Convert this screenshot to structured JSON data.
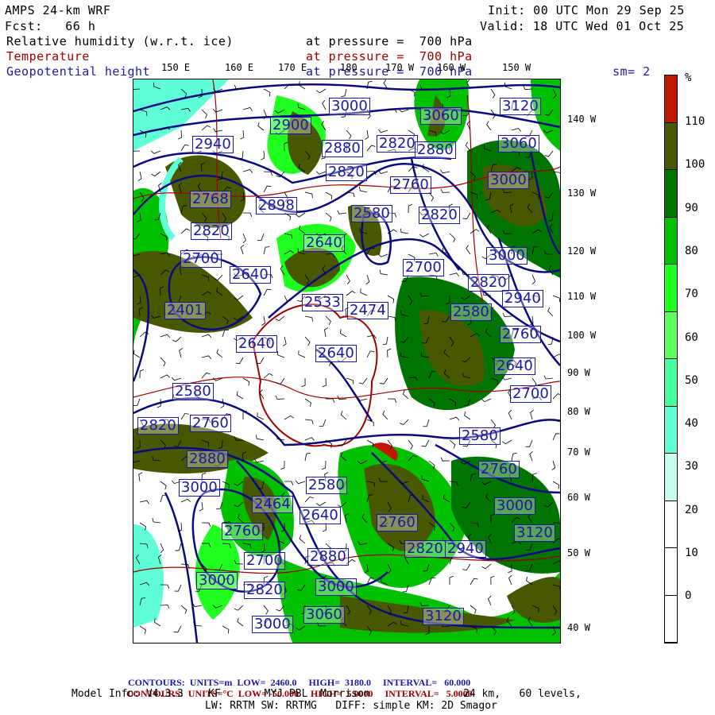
{
  "header": {
    "model": "AMPS 24-km WRF",
    "fcst": "Fcst:   66 h",
    "init": "Init: 00 UTC Mon 29 Sep 25",
    "valid": "Valid: 18 UTC Wed 01 Oct 25",
    "fields": [
      {
        "name": "Relative humidity (w.r.t. ice)",
        "level": "at pressure =  700 hPa"
      },
      {
        "name": "Temperature",
        "level": "at pressure =  700 hPa"
      },
      {
        "name": "Geopotential height",
        "level": "at pressure =  700 hPa"
      }
    ],
    "smoothing": "sm= 2"
  },
  "axes": {
    "top": [
      "150 E",
      "160 E",
      "170 E",
      "180",
      "170 W",
      "160 W",
      "150 W"
    ],
    "right": [
      "140 W",
      "130 W",
      "120 W",
      "110 W",
      "100 W",
      "90 W",
      "80 W",
      "70 W",
      "60 W",
      "50 W",
      "40 W"
    ]
  },
  "colorbar": {
    "unit": "%",
    "labels": [
      "110",
      "100",
      "90",
      "80",
      "70",
      "60",
      "50",
      "40",
      "30",
      "20",
      "10",
      "0"
    ],
    "colors": [
      "#c01800",
      "#485800",
      "#007400",
      "#00c000",
      "#20ff20",
      "#60ff60",
      "#48ffa0",
      "#60ffd8",
      "#c8fff0",
      "#ffffff",
      "#ffffff",
      "#ffffff",
      "#ffffff"
    ]
  },
  "map": {
    "contour_labels": [
      "3000",
      "3060",
      "3120",
      "2900",
      "2940",
      "2880",
      "2820",
      "2880",
      "3060",
      "2768",
      "2898",
      "2820",
      "3000",
      "2760",
      "2580",
      "2820",
      "2820",
      "2640",
      "2700",
      "2640",
      "2700",
      "3000",
      "2820",
      "2533",
      "2474",
      "2401",
      "2940",
      "2580",
      "2760",
      "2640",
      "2640",
      "2580",
      "2820",
      "2760",
      "2880",
      "3000",
      "2580",
      "2464",
      "2760",
      "2640",
      "2760",
      "2700",
      "2880",
      "2820",
      "2940",
      "3000",
      "2820",
      "3000",
      "3060",
      "3000",
      "3120",
      "3000",
      "3120",
      "2760",
      "2580",
      "2700",
      "2640"
    ]
  },
  "footer": {
    "height_contours": {
      "label": "CONTOURS:",
      "units": "UNITS=m",
      "low": "LOW=  2460.0",
      "high": "HIGH=  3180.0",
      "interval": "INTERVAL=   60.000"
    },
    "temp_contours": {
      "label": "CONTOURS:",
      "units": "UNITS=°C",
      "low": "LOW= -50.000",
      "high": "HIGH=  5.0000",
      "interval": "INTERVAL=   5.0000"
    },
    "model_info": "Model Info: V4.3.3    KF       MYJ PBL  Morrison               24 km,   60 levels,",
    "model_info2": "LW: RRTM SW: RRTMG   DIFF: simple KM: 2D Smagor"
  }
}
